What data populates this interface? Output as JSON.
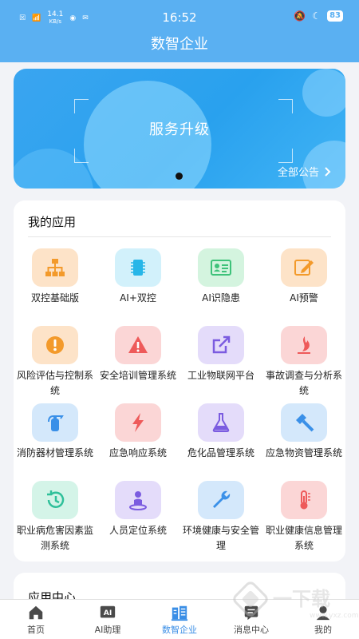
{
  "status_bar": {
    "time": "16:52",
    "net_speed": "14.1",
    "net_unit": "KB/s",
    "battery": "83"
  },
  "header": {
    "title": "数智企业"
  },
  "banner": {
    "title": "服务升级",
    "link": "全部公告"
  },
  "apps_card": {
    "title": "我的应用",
    "items": [
      {
        "label": "双控基础版",
        "icon": "org-chart-icon",
        "bg": "#fde3c8",
        "fg": "#f39a2b"
      },
      {
        "label": "AI+双控",
        "icon": "chip-icon",
        "bg": "#d2f1fb",
        "fg": "#27b6e8"
      },
      {
        "label": "AI识隐患",
        "icon": "id-card-icon",
        "bg": "#d4f4df",
        "fg": "#3ec27a"
      },
      {
        "label": "AI预警",
        "icon": "edit-note-icon",
        "bg": "#fde3c8",
        "fg": "#f39a2b"
      },
      {
        "label": "风险评估与控制系统",
        "icon": "exclamation-icon",
        "bg": "#fde3c8",
        "fg": "#f39a2b"
      },
      {
        "label": "安全培训管理系统",
        "icon": "warning-triangle-icon",
        "bg": "#fbd6d6",
        "fg": "#ee5a5a"
      },
      {
        "label": "工业物联网平台",
        "icon": "share-box-icon",
        "bg": "#e4dcfa",
        "fg": "#7b5ce0"
      },
      {
        "label": "事故调查与分析系统",
        "icon": "flame-icon",
        "bg": "#fbd6d6",
        "fg": "#ee5a5a"
      },
      {
        "label": "消防器材管理系统",
        "icon": "fire-extinguisher-icon",
        "bg": "#d4e8fb",
        "fg": "#3a90e8"
      },
      {
        "label": "应急响应系统",
        "icon": "lightning-icon",
        "bg": "#fbd6d6",
        "fg": "#ee5a5a"
      },
      {
        "label": "危化品管理系统",
        "icon": "flask-icon",
        "bg": "#e4dcfa",
        "fg": "#7b5ce0"
      },
      {
        "label": "应急物资管理系统",
        "icon": "hammer-icon",
        "bg": "#d4e8fb",
        "fg": "#3a90e8"
      },
      {
        "label": "职业病危害因素监测系统",
        "icon": "history-clock-icon",
        "bg": "#d4f4e8",
        "fg": "#2fc09a"
      },
      {
        "label": "人员定位系统",
        "icon": "person-pin-icon",
        "bg": "#e4dcfa",
        "fg": "#7b5ce0"
      },
      {
        "label": "环境健康与安全管理",
        "icon": "wrench-icon",
        "bg": "#d4e8fb",
        "fg": "#3a90e8"
      },
      {
        "label": "职业健康信息管理系统",
        "icon": "thermometer-icon",
        "bg": "#fbd6d6",
        "fg": "#ee5a5a"
      }
    ]
  },
  "app_center": {
    "title": "应用中心"
  },
  "tabbar": {
    "items": [
      {
        "label": "首页",
        "icon": "home-icon"
      },
      {
        "label": "AI助理",
        "icon": "ai-icon"
      },
      {
        "label": "数智企业",
        "icon": "enterprise-icon",
        "active": true
      },
      {
        "label": "消息中心",
        "icon": "message-icon"
      },
      {
        "label": "我的",
        "icon": "profile-icon"
      }
    ]
  },
  "watermark": {
    "text": "一下载",
    "url": "www.yxz.com"
  },
  "colors": {
    "accent": "#5ab0f2",
    "tab_active": "#3a8ee6"
  }
}
